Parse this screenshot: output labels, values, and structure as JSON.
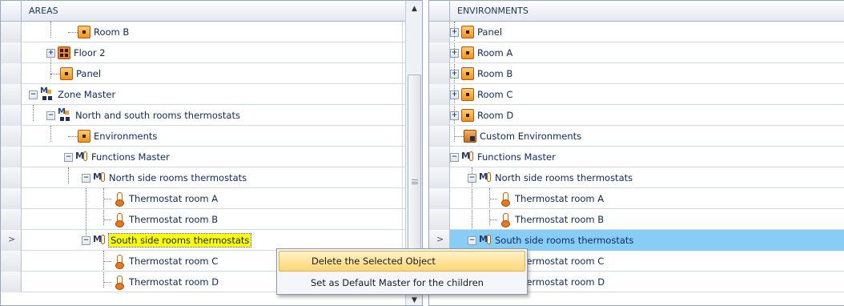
{
  "areas_pane": {
    "header": "AREAS",
    "rows": [
      {
        "label": "Room B"
      },
      {
        "label": "Floor 2"
      },
      {
        "label": "Panel"
      },
      {
        "label": "Zone Master"
      },
      {
        "label": "North and south rooms thermostats"
      },
      {
        "label": "Environments"
      },
      {
        "label": "Functions Master"
      },
      {
        "label": "North side rooms thermostats"
      },
      {
        "label": "Thermostat room A"
      },
      {
        "label": "Thermostat room B"
      },
      {
        "label": "South side rooms thermostats"
      },
      {
        "label": "Thermostat room C"
      },
      {
        "label": "Thermostat room D"
      }
    ]
  },
  "environments_pane": {
    "header": "ENVIRONMENTS",
    "rows": [
      {
        "label": "Panel"
      },
      {
        "label": "Room A"
      },
      {
        "label": "Room B"
      },
      {
        "label": "Room C"
      },
      {
        "label": "Room D"
      },
      {
        "label": "Custom Environments"
      },
      {
        "label": "Functions Master"
      },
      {
        "label": "North side rooms thermostats"
      },
      {
        "label": "Thermostat room A"
      },
      {
        "label": "Thermostat room B"
      },
      {
        "label": "South side rooms thermostats"
      },
      {
        "label": "Thermostat room C"
      },
      {
        "label": "Thermostat room D"
      }
    ]
  },
  "row_marker": ">",
  "expander_plus": "+",
  "expander_minus": "−",
  "scrollbar": {
    "up_arrow": "▲",
    "down_arrow": "▼"
  },
  "context_menu": {
    "items": [
      {
        "label": "Delete the Selected Object",
        "highlighted": true
      },
      {
        "label": "Set as Default Master for the children"
      }
    ]
  },
  "colors": {
    "selection_yellow": "#ffff00",
    "selection_blue": "#88cdf6",
    "menu_highlight": "#ffd676"
  }
}
